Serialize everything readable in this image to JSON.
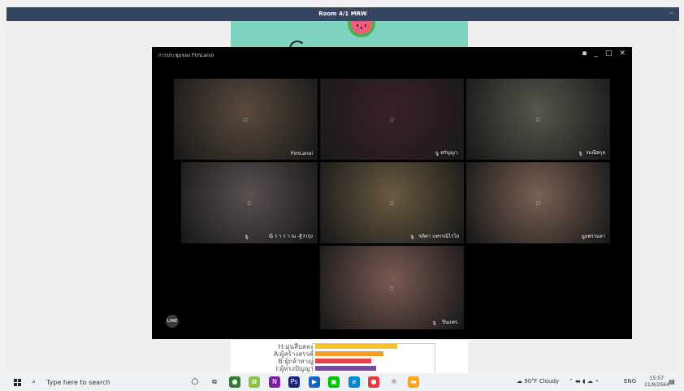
{
  "window": {
    "title": "Room 4/1 MRW"
  },
  "call": {
    "title": "การประชุมของ PimLanoi",
    "controls": [
      "pin-icon",
      "minimize-icon",
      "maximize-icon",
      "close-icon"
    ],
    "participants": [
      {
        "name": "PimLanoi",
        "bg": "#5a4a3c",
        "mic_icon": ""
      },
      {
        "name": "สกัญญา.",
        "bg": "#3a1f2a",
        "mic_icon": "🎙"
      },
      {
        "name": "รมณีสกุล",
        "bg": "#55584c",
        "mic_icon": "🎙"
      },
      {
        "name": "ณี ร า ร า ณ -ฐิว่ากุ่ง",
        "bg": "#5a5050",
        "mic_icon": "🎙"
      },
      {
        "name": "ชลิตา แพรรณีไรโย",
        "bg": "#6a5a40",
        "mic_icon": "🎙"
      },
      {
        "name": "แพรวนลา",
        "bg": "#7a6052",
        "mic_icon": "🎙"
      },
      {
        "name": "ปิ่นแพร.",
        "bg": "#7a5a52",
        "mic_icon": "🎙"
      }
    ],
    "logo_text": "LINE"
  },
  "slide": {
    "poll": [
      {
        "label": "H:มุ่นสืบสละ",
        "value": 0.67,
        "color": "#f7c12b"
      },
      {
        "label": "A:ผู้สร้างสรรค์",
        "value": 0.56,
        "color": "#f39c2b"
      },
      {
        "label": "B:ผู้กล้าหาญ",
        "value": 0.46,
        "color": "#e8404a"
      },
      {
        "label": "I:ผู้ทรงปัญญา",
        "value": 0.5,
        "color": "#7b4aa0"
      }
    ]
  },
  "taskbar": {
    "search_placeholder": "Type here to search",
    "weather": "90°F  Cloudy",
    "language": "ENG",
    "time": "15:57",
    "date": "11/9/2564"
  }
}
